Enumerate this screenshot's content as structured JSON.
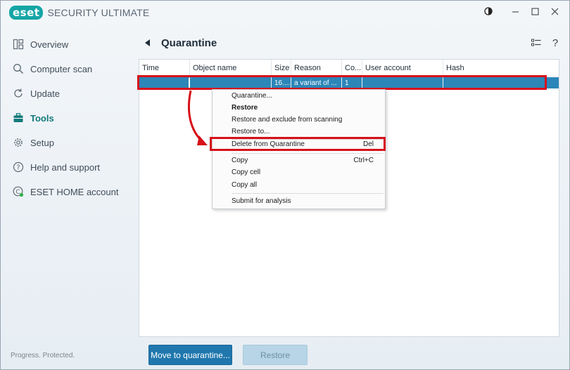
{
  "app": {
    "logo": "eset",
    "title": "SECURITY ULTIMATE"
  },
  "window_controls": [
    "theme-icon",
    "minimize-icon",
    "maximize-icon",
    "close-icon"
  ],
  "sidebar": {
    "items": [
      {
        "label": "Overview",
        "icon": "overview-icon"
      },
      {
        "label": "Computer scan",
        "icon": "search-icon"
      },
      {
        "label": "Update",
        "icon": "refresh-icon"
      },
      {
        "label": "Tools",
        "icon": "briefcase-icon",
        "active": true
      },
      {
        "label": "Setup",
        "icon": "gear-icon"
      },
      {
        "label": "Help and support",
        "icon": "help-icon"
      },
      {
        "label": "ESET HOME account",
        "icon": "eset-home-icon"
      }
    ],
    "status": "Progress. Protected."
  },
  "page": {
    "title": "Quarantine"
  },
  "table": {
    "columns": [
      "Time",
      "Object name",
      "Size",
      "Reason",
      "Co...",
      "User account",
      "Hash"
    ],
    "rows": [
      {
        "time": "",
        "object_name": "",
        "size": "16....",
        "reason": "a variant of ...",
        "count": "1",
        "user_account": "",
        "hash": ""
      }
    ]
  },
  "context_menu": {
    "items": [
      {
        "label": "Quarantine...",
        "shortcut": ""
      },
      {
        "label": "Restore",
        "shortcut": "",
        "bold": true
      },
      {
        "label": "Restore and exclude from scanning",
        "shortcut": ""
      },
      {
        "label": "Restore to...",
        "shortcut": ""
      },
      {
        "label": "Delete from Quarantine",
        "shortcut": "Del",
        "highlighted": true
      },
      {
        "label": "Copy",
        "shortcut": "Ctrl+C"
      },
      {
        "label": "Copy cell",
        "shortcut": ""
      },
      {
        "label": "Copy all",
        "shortcut": ""
      },
      {
        "label": "Submit for analysis",
        "shortcut": ""
      }
    ]
  },
  "buttons": {
    "move_to_quarantine": "Move to quarantine...",
    "restore": "Restore"
  },
  "colors": {
    "accent": "#16a5a6",
    "primary_button": "#1f77ad",
    "selection": "#2c86b8",
    "highlight_box": "#d7101a"
  }
}
